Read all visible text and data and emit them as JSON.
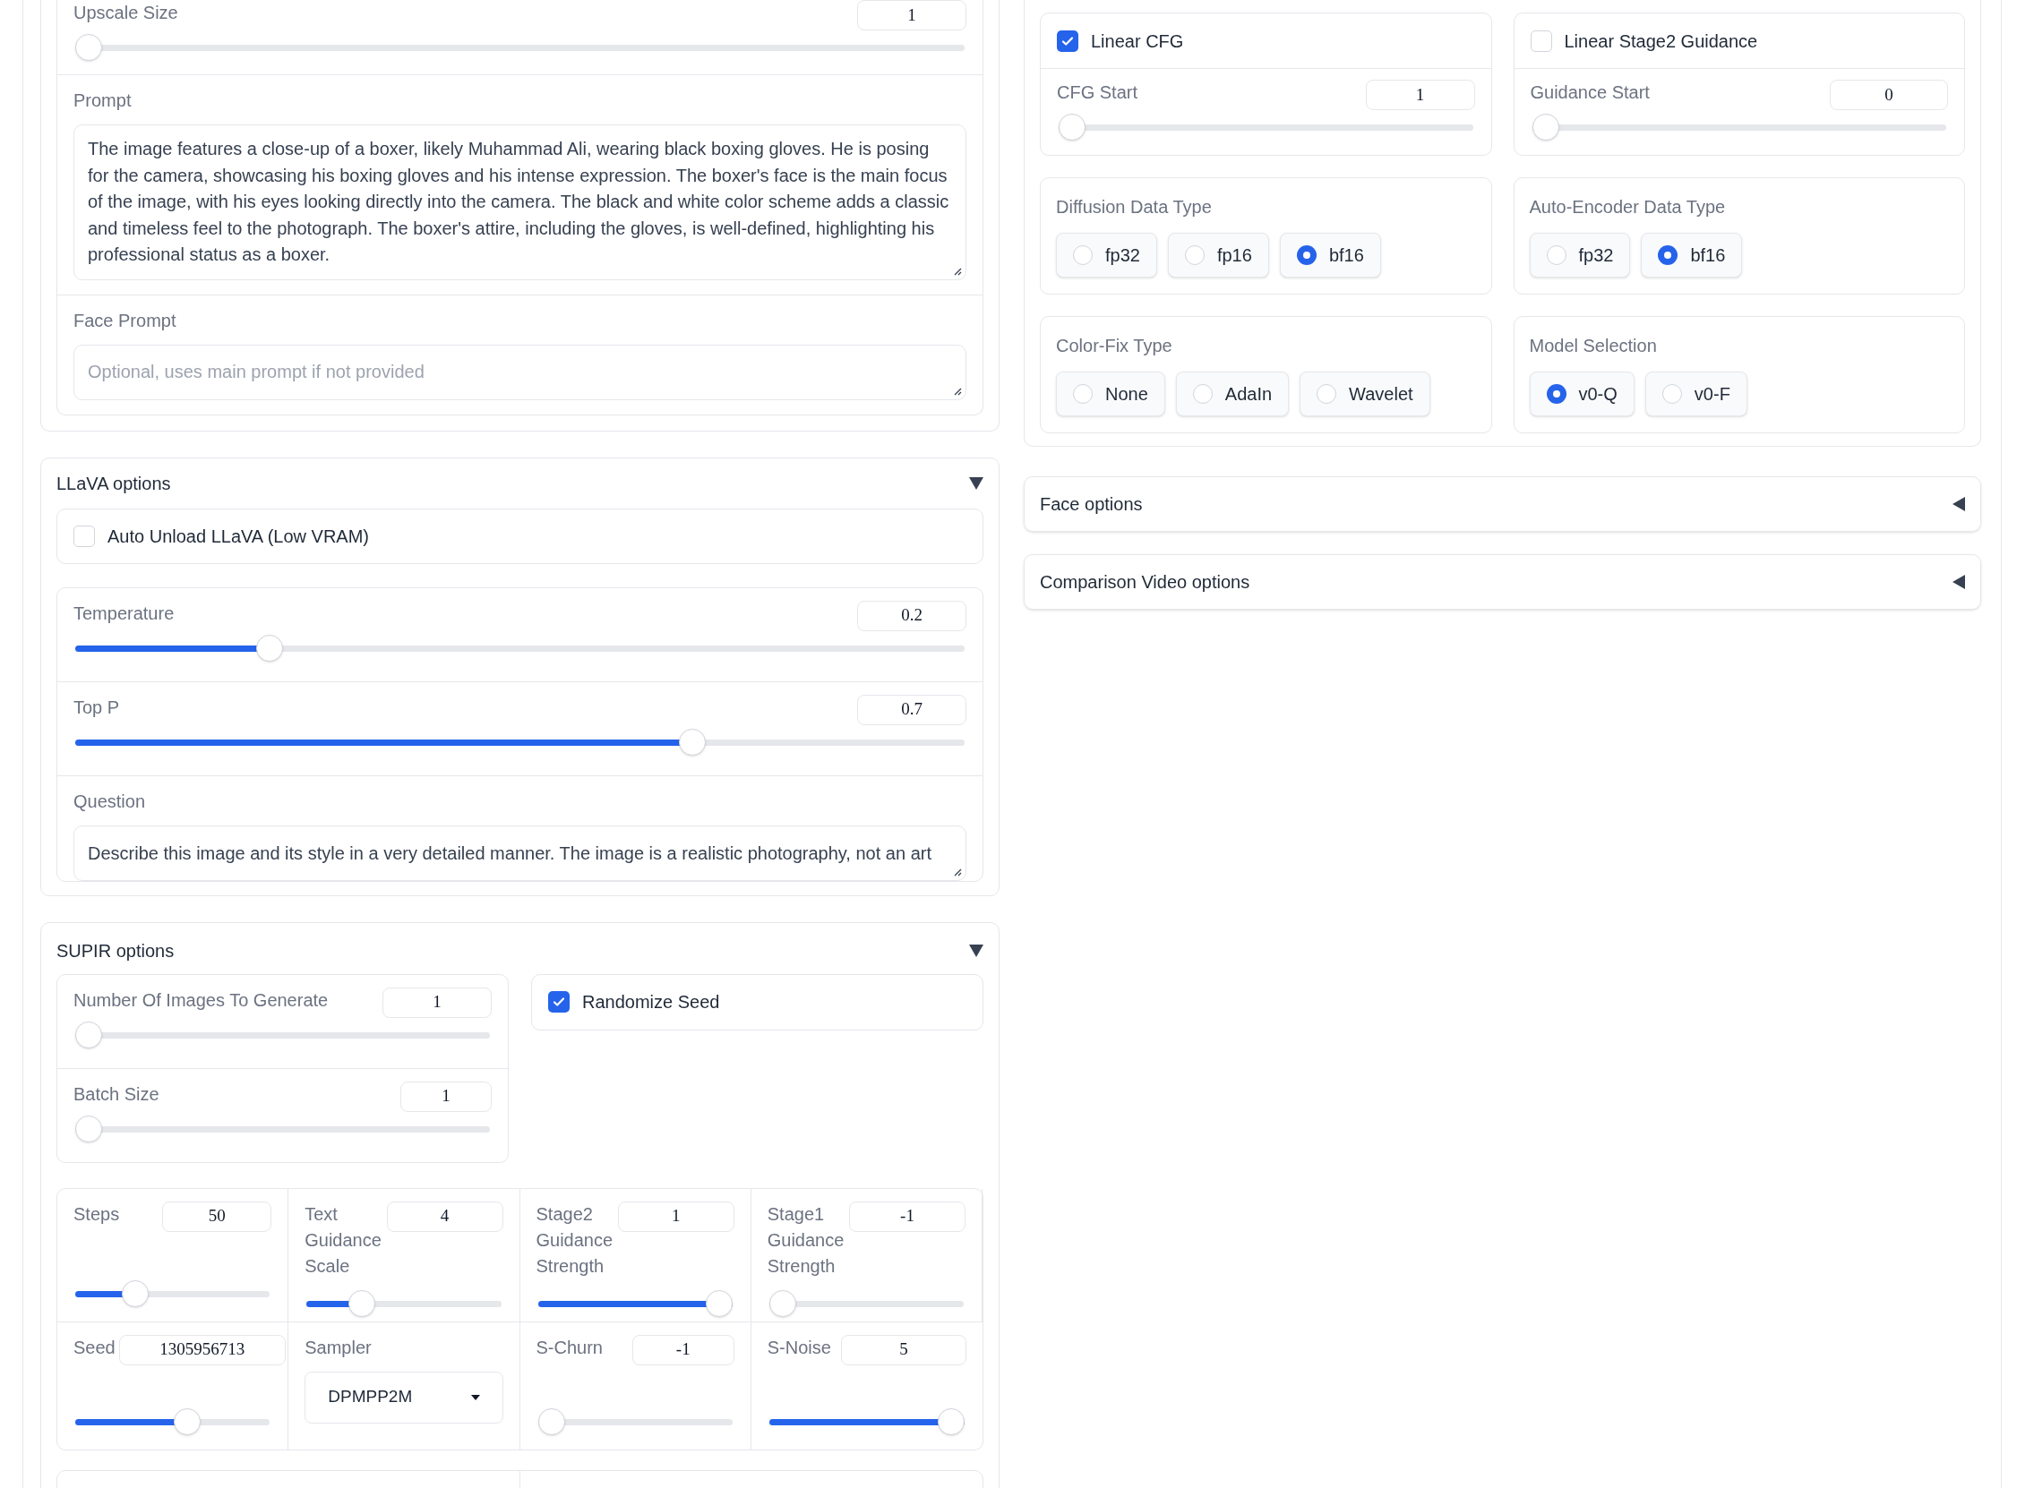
{
  "upscale_size": {
    "label": "Upscale Size",
    "value": "1",
    "level": 0
  },
  "prompt": {
    "label": "Prompt",
    "value": "The image features a close-up of a boxer, likely Muhammad Ali, wearing black boxing gloves. He is posing for the camera, showcasing his boxing gloves and his intense expression. The boxer's face is the main focus of the image, with his eyes looking directly into the camera. The black and white color scheme adds a classic and timeless feel to the photograph. The boxer's attire, including the gloves, is well-defined, highlighting his professional status as a boxer."
  },
  "face_prompt": {
    "label": "Face Prompt",
    "placeholder": "Optional, uses main prompt if not provided"
  },
  "llava_options": {
    "title": "LLaVA options",
    "expanded": true,
    "auto_unload": {
      "label": "Auto Unload LLaVA (Low VRAM)",
      "checked": false
    },
    "temperature": {
      "label": "Temperature",
      "value": "0.2",
      "level": 0.21
    },
    "top_p": {
      "label": "Top P",
      "value": "0.7",
      "level": 0.7
    },
    "question": {
      "label": "Question",
      "value": "Describe this image and its style in a very detailed manner. The image is a realistic photography, not an art"
    }
  },
  "supir_options": {
    "title": "SUPIR options",
    "expanded": true,
    "num_images": {
      "label": "Number Of Images To Generate",
      "value": "1",
      "level": 0
    },
    "batch_size": {
      "label": "Batch Size",
      "value": "1",
      "level": 0
    },
    "randomize_seed": {
      "label": "Randomize Seed",
      "checked": true
    },
    "grid": [
      {
        "kind": "slider",
        "label": "Steps",
        "value": "50",
        "level": 0.28
      },
      {
        "kind": "slider",
        "label": "Text Guidance Scale",
        "value": "4",
        "level": 0.25
      },
      {
        "kind": "slider",
        "label": "Stage2 Guidance Strength",
        "value": "1",
        "level": 1
      },
      {
        "kind": "slider",
        "label": "Stage1 Guidance Strength",
        "value": "-1",
        "level": 0
      },
      {
        "kind": "slider",
        "label": "Seed",
        "value": "1305956713",
        "level": 0.59
      },
      {
        "kind": "dropdown",
        "label": "Sampler",
        "value": "DPMPP2M"
      },
      {
        "kind": "slider",
        "label": "S-Churn",
        "value": "-1",
        "level": 0
      },
      {
        "kind": "slider",
        "label": "S-Noise",
        "value": "5",
        "level": 1
      }
    ]
  },
  "linear_cfg": {
    "label": "Linear CFG",
    "checked": true,
    "start": {
      "label": "CFG Start",
      "value": "1",
      "level": 0
    }
  },
  "linear_stage2_guidance": {
    "label": "Linear Stage2 Guidance",
    "checked": false,
    "start": {
      "label": "Guidance Start",
      "value": "0",
      "level": 0
    }
  },
  "diffusion_data_type": {
    "label": "Diffusion Data Type",
    "options": [
      {
        "label": "fp32",
        "selected": false
      },
      {
        "label": "fp16",
        "selected": false
      },
      {
        "label": "bf16",
        "selected": true
      }
    ]
  },
  "auto_encoder_data_type": {
    "label": "Auto-Encoder Data Type",
    "options": [
      {
        "label": "fp32",
        "selected": false
      },
      {
        "label": "bf16",
        "selected": true
      }
    ]
  },
  "color_fix_type": {
    "label": "Color-Fix Type",
    "options": [
      {
        "label": "None",
        "selected": false
      },
      {
        "label": "AdaIn",
        "selected": false
      },
      {
        "label": "Wavelet",
        "selected": false
      }
    ]
  },
  "model_selection": {
    "label": "Model Selection",
    "options": [
      {
        "label": "v0-Q",
        "selected": true
      },
      {
        "label": "v0-F",
        "selected": false
      }
    ]
  },
  "face_options": {
    "title": "Face options",
    "expanded": false
  },
  "comparison_video_options": {
    "title": "Comparison Video options",
    "expanded": false
  }
}
